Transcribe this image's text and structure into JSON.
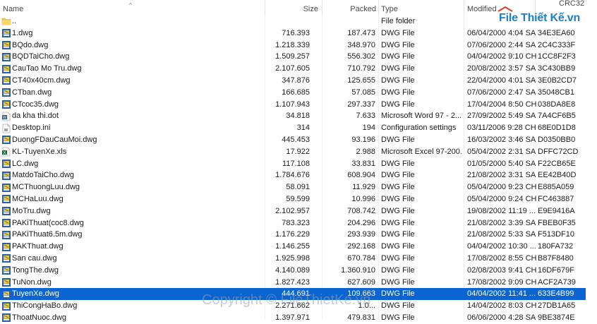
{
  "columns": {
    "name": "Name",
    "size": "Size",
    "packed": "Packed",
    "type": "Type",
    "modified": "Modified",
    "crc": "CRC32"
  },
  "logo": "File Thiết Kế.vn",
  "watermark": "Copyright © FileThietKe.vn",
  "colors": {
    "selection": "#0a64d2",
    "logo": "#1d80c7"
  },
  "rows": [
    {
      "icon": "folder-icon",
      "name": "..",
      "size": "",
      "packed": "",
      "type": "File folder",
      "modified": "",
      "crc": ""
    },
    {
      "icon": "dwg-file-icon",
      "name": "1.dwg",
      "size": "716.393",
      "packed": "187.473",
      "type": "DWG File",
      "modified": "06/04/2000 4:04 SA",
      "crc": "34E3EA60"
    },
    {
      "icon": "dwg-file-icon",
      "name": "BQdo.dwg",
      "size": "1.218.339",
      "packed": "348.970",
      "type": "DWG File",
      "modified": "07/06/2000 2:44 SA",
      "crc": "2C4C333F"
    },
    {
      "icon": "dwg-file-icon",
      "name": "BQDTaiCho.dwg",
      "size": "1.509.257",
      "packed": "556.302",
      "type": "DWG File",
      "modified": "04/04/2002 9:10 CH",
      "crc": "1CC8F2F3"
    },
    {
      "icon": "dwg-file-icon",
      "name": "CauTao Mo Tru.dwg",
      "size": "2.107.605",
      "packed": "710.792",
      "type": "DWG File",
      "modified": "20/08/2002 3:57 SA",
      "crc": "3C430BB9"
    },
    {
      "icon": "dwg-file-icon",
      "name": "CT40x40cm.dwg",
      "size": "347.876",
      "packed": "125.655",
      "type": "DWG File",
      "modified": "22/04/2000 4:01 SA",
      "crc": "3E0B2CD7"
    },
    {
      "icon": "dwg-file-icon",
      "name": "CTban.dwg",
      "size": "166.685",
      "packed": "57.085",
      "type": "DWG File",
      "modified": "07/06/2000 2:47 SA",
      "crc": "35048CB1"
    },
    {
      "icon": "dwg-file-icon",
      "name": "CTcoc35.dwg",
      "size": "1.107.943",
      "packed": "297.337",
      "type": "DWG File",
      "modified": "17/04/2004 8:50 CH",
      "crc": "038DA8E8"
    },
    {
      "icon": "word-file-icon",
      "name": "da kha thi.dot",
      "size": "34.818",
      "packed": "7.633",
      "type": "Microsoft Word 97 - 2...",
      "modified": "27/09/2002 5:49 SA",
      "crc": "7A4CF6B5"
    },
    {
      "icon": "ini-file-icon",
      "name": "Desktop.ini",
      "size": "314",
      "packed": "194",
      "type": "Configuration settings",
      "modified": "03/11/2006 9:28 CH",
      "crc": "68E0D1D8"
    },
    {
      "icon": "dwg-file-icon",
      "name": "DuongFDauCauMoi.dwg",
      "size": "445.453",
      "packed": "93.196",
      "type": "DWG File",
      "modified": "16/03/2002 3:46 SA",
      "crc": "D0350BB0"
    },
    {
      "icon": "excel-file-icon",
      "name": "KL-TuyenXe.xls",
      "size": "17.922",
      "packed": "2.988",
      "type": "Microsoft Excel 97-200...",
      "modified": "05/04/2002 2:31 SA",
      "crc": "DFFC72CD"
    },
    {
      "icon": "dwg-file-icon",
      "name": "LC.dwg",
      "size": "117.108",
      "packed": "33.831",
      "type": "DWG File",
      "modified": "01/05/2000 5:40 SA",
      "crc": "F22CB65E"
    },
    {
      "icon": "dwg-file-icon",
      "name": "MatdoTaiCho.dwg",
      "size": "1.784.676",
      "packed": "608.904",
      "type": "DWG File",
      "modified": "21/08/2002 3:31 SA",
      "crc": "EE42B40D"
    },
    {
      "icon": "dwg-file-icon",
      "name": "MCThuongLuu.dwg",
      "size": "58.091",
      "packed": "11.929",
      "type": "DWG File",
      "modified": "05/04/2000 9:23 CH",
      "crc": "E885A059"
    },
    {
      "icon": "dwg-file-icon",
      "name": "MCHaLuu.dwg",
      "size": "59.599",
      "packed": "10.996",
      "type": "DWG File",
      "modified": "05/04/2000 9:24 CH",
      "crc": "FC463887"
    },
    {
      "icon": "dwg-file-icon",
      "name": "MoTru.dwg",
      "size": "2.102.957",
      "packed": "708.742",
      "type": "DWG File",
      "modified": "19/08/2002 11:19 ...",
      "crc": "E9E9416A"
    },
    {
      "icon": "dwg-file-icon",
      "name": "PAKiThuat(coc8.dwg",
      "size": "783.323",
      "packed": "204.296",
      "type": "DWG File",
      "modified": "21/08/2002 3:39 SA",
      "crc": "FBEB0F35"
    },
    {
      "icon": "dwg-file-icon",
      "name": "PAKiThuat6.5m.dwg",
      "size": "1.176.229",
      "packed": "293.939",
      "type": "DWG File",
      "modified": "21/08/2002 5:33 SA",
      "crc": "F513DF10"
    },
    {
      "icon": "dwg-file-icon",
      "name": "PAKThuat.dwg",
      "size": "1.146.255",
      "packed": "292.168",
      "type": "DWG File",
      "modified": "04/04/2002 10:30 ...",
      "crc": "180FA732"
    },
    {
      "icon": "dwg-file-icon",
      "name": "San cau.dwg",
      "size": "1.925.998",
      "packed": "670.784",
      "type": "DWG File",
      "modified": "17/08/2002 8:55 CH",
      "crc": "B87F8480"
    },
    {
      "icon": "dwg-file-icon",
      "name": "TongThe.dwg",
      "size": "4.140.089",
      "packed": "1.360.910",
      "type": "DWG File",
      "modified": "02/08/2003 9:41 CH",
      "crc": "16DF679F"
    },
    {
      "icon": "dwg-file-icon",
      "name": "TuNon.dwg",
      "size": "1.827.423",
      "packed": "627.609",
      "type": "DWG File",
      "modified": "17/08/2002 9:09 CH",
      "crc": "ACF2A739"
    },
    {
      "icon": "dwg-file-icon",
      "name": "TuyenXe.dwg",
      "size": "444.691",
      "packed": "109.663",
      "type": "DWG File",
      "modified": "04/04/2002 11:41 ...",
      "crc": "633E4B99",
      "selected": true
    },
    {
      "icon": "dwg-file-icon",
      "name": "ThiCongHaBo.dwg",
      "size": "2.271.662",
      "packed": "1.0...",
      "type": "DWG File",
      "modified": "14/04/2002 8:03 CH",
      "crc": "27DB1A65"
    },
    {
      "icon": "dwg-file-icon",
      "name": "ThoatNuoc.dwg",
      "size": "1.397.971",
      "packed": "479.831",
      "type": "DWG File",
      "modified": "06/06/2000 4:28 SA",
      "crc": "9BE3874E"
    }
  ]
}
